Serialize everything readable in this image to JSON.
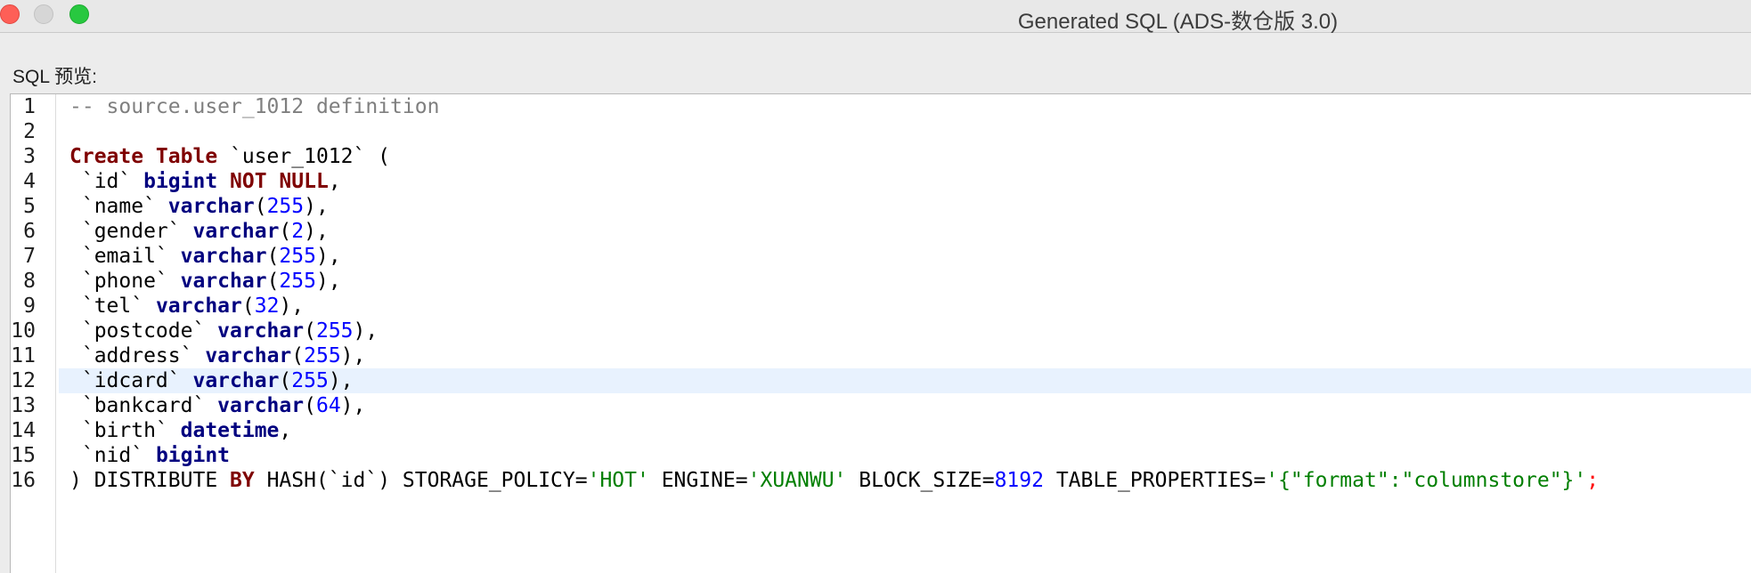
{
  "window": {
    "title": "Generated SQL (ADS-数仓版 3.0)"
  },
  "panel": {
    "label": "SQL 预览:"
  },
  "editor": {
    "current_line": 12,
    "lines": [
      {
        "n": "1",
        "tokens": [
          {
            "t": "-- source.user_1012 definition",
            "c": "cmt"
          }
        ]
      },
      {
        "n": "2",
        "tokens": []
      },
      {
        "n": "3",
        "tokens": [
          {
            "t": "Create Table",
            "c": "kw"
          },
          {
            "t": " `user_1012` (",
            "c": ""
          }
        ]
      },
      {
        "n": "4",
        "tokens": [
          {
            "t": " `id` ",
            "c": ""
          },
          {
            "t": "bigint",
            "c": "ty"
          },
          {
            "t": " ",
            "c": ""
          },
          {
            "t": "NOT NULL",
            "c": "kw"
          },
          {
            "t": ",",
            "c": ""
          }
        ]
      },
      {
        "n": "5",
        "tokens": [
          {
            "t": " `name` ",
            "c": ""
          },
          {
            "t": "varchar",
            "c": "ty"
          },
          {
            "t": "(",
            "c": ""
          },
          {
            "t": "255",
            "c": "num"
          },
          {
            "t": "),",
            "c": ""
          }
        ]
      },
      {
        "n": "6",
        "tokens": [
          {
            "t": " `gender` ",
            "c": ""
          },
          {
            "t": "varchar",
            "c": "ty"
          },
          {
            "t": "(",
            "c": ""
          },
          {
            "t": "2",
            "c": "num"
          },
          {
            "t": "),",
            "c": ""
          }
        ]
      },
      {
        "n": "7",
        "tokens": [
          {
            "t": " `email` ",
            "c": ""
          },
          {
            "t": "varchar",
            "c": "ty"
          },
          {
            "t": "(",
            "c": ""
          },
          {
            "t": "255",
            "c": "num"
          },
          {
            "t": "),",
            "c": ""
          }
        ]
      },
      {
        "n": "8",
        "tokens": [
          {
            "t": " `phone` ",
            "c": ""
          },
          {
            "t": "varchar",
            "c": "ty"
          },
          {
            "t": "(",
            "c": ""
          },
          {
            "t": "255",
            "c": "num"
          },
          {
            "t": "),",
            "c": ""
          }
        ]
      },
      {
        "n": "9",
        "tokens": [
          {
            "t": " `tel` ",
            "c": ""
          },
          {
            "t": "varchar",
            "c": "ty"
          },
          {
            "t": "(",
            "c": ""
          },
          {
            "t": "32",
            "c": "num"
          },
          {
            "t": "),",
            "c": ""
          }
        ]
      },
      {
        "n": "10",
        "tokens": [
          {
            "t": " `postcode` ",
            "c": ""
          },
          {
            "t": "varchar",
            "c": "ty"
          },
          {
            "t": "(",
            "c": ""
          },
          {
            "t": "255",
            "c": "num"
          },
          {
            "t": "),",
            "c": ""
          }
        ]
      },
      {
        "n": "11",
        "tokens": [
          {
            "t": " `address` ",
            "c": ""
          },
          {
            "t": "varchar",
            "c": "ty"
          },
          {
            "t": "(",
            "c": ""
          },
          {
            "t": "255",
            "c": "num"
          },
          {
            "t": "),",
            "c": ""
          }
        ]
      },
      {
        "n": "12",
        "tokens": [
          {
            "t": " `idcard` ",
            "c": ""
          },
          {
            "t": "varchar",
            "c": "ty"
          },
          {
            "t": "(",
            "c": ""
          },
          {
            "t": "255",
            "c": "num"
          },
          {
            "t": "),",
            "c": ""
          }
        ]
      },
      {
        "n": "13",
        "tokens": [
          {
            "t": " `bankcard` ",
            "c": ""
          },
          {
            "t": "varchar",
            "c": "ty"
          },
          {
            "t": "(",
            "c": ""
          },
          {
            "t": "64",
            "c": "num"
          },
          {
            "t": "),",
            "c": ""
          }
        ]
      },
      {
        "n": "14",
        "tokens": [
          {
            "t": " `birth` ",
            "c": ""
          },
          {
            "t": "datetime",
            "c": "ty"
          },
          {
            "t": ",",
            "c": ""
          }
        ]
      },
      {
        "n": "15",
        "tokens": [
          {
            "t": " `nid` ",
            "c": ""
          },
          {
            "t": "bigint",
            "c": "ty"
          }
        ]
      },
      {
        "n": "16",
        "tokens": [
          {
            "t": ") DISTRIBUTE ",
            "c": ""
          },
          {
            "t": "BY",
            "c": "kw"
          },
          {
            "t": " HASH(`id`) STORAGE_POLICY=",
            "c": ""
          },
          {
            "t": "'HOT'",
            "c": "str"
          },
          {
            "t": " ENGINE=",
            "c": ""
          },
          {
            "t": "'XUANWU'",
            "c": "str"
          },
          {
            "t": " BLOCK_SIZE=",
            "c": ""
          },
          {
            "t": "8192",
            "c": "num"
          },
          {
            "t": " TABLE_PROPERTIES=",
            "c": ""
          },
          {
            "t": "'{\"format\":\"columnstore\"}'",
            "c": "str"
          },
          {
            "t": ";",
            "c": "semi"
          }
        ]
      }
    ]
  }
}
